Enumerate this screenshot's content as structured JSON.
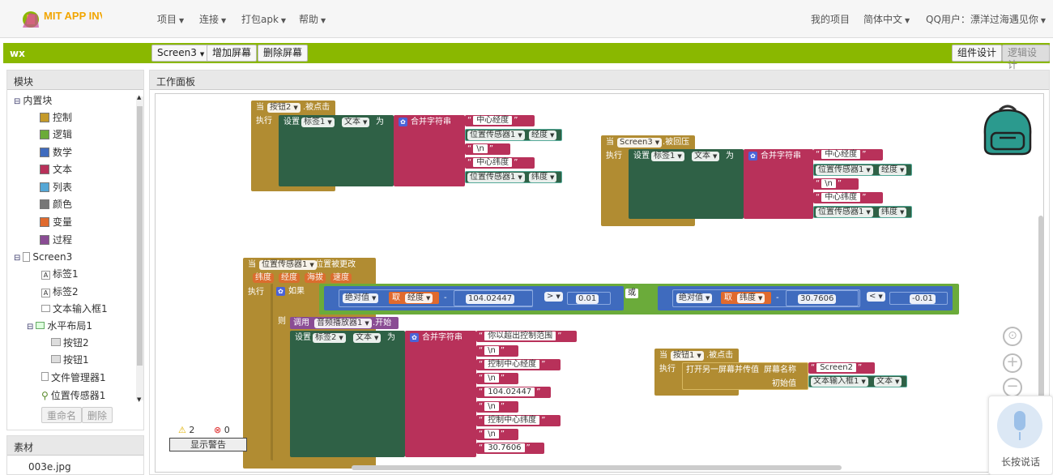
{
  "topbar": {
    "logo_text": "MIT APP INVENTOR",
    "menus": [
      "项目",
      "连接",
      "打包apk",
      "帮助"
    ],
    "my_projects": "我的项目",
    "language": "简体中文",
    "user": "QQ用户：漂洋过海遇见你"
  },
  "projbar": {
    "project_name": "wx",
    "screen_select": "Screen3",
    "add_screen": "增加屏幕",
    "remove_screen": "删除屏幕",
    "designer": "组件设计",
    "blocks": "逻辑设计"
  },
  "left": {
    "title": "模块",
    "builtin": "内置块",
    "builtin_items": [
      {
        "label": "控制",
        "color": "#c49a2a"
      },
      {
        "label": "逻辑",
        "color": "#6bab3a"
      },
      {
        "label": "数学",
        "color": "#3f6bbe"
      },
      {
        "label": "文本",
        "color": "#b8315a"
      },
      {
        "label": "列表",
        "color": "#55a7d6"
      },
      {
        "label": "颜色",
        "color": "#777777"
      },
      {
        "label": "变量",
        "color": "#e06a2e"
      },
      {
        "label": "过程",
        "color": "#8a4c94"
      }
    ],
    "screen": "Screen3",
    "components": [
      "标签1",
      "标签2",
      "文本输入框1",
      "水平布局1",
      "按钮2",
      "按钮1",
      "文件管理器1",
      "位置传感器1"
    ],
    "rename": "重命名",
    "delete": "删除"
  },
  "media": {
    "title": "素材",
    "files": [
      "003e.jpg"
    ]
  },
  "work": {
    "title": "工作面板",
    "warnings": "2",
    "errors": "0",
    "show_warnings": "显示警告",
    "mic_label": "长按说话"
  },
  "blocks": {
    "b1": {
      "when": "当",
      "comp": "按钮2",
      "event": ".被点击",
      "do": "执行",
      "set": "设置",
      "target": "标签1",
      "prop": "文本",
      "to": "为",
      "join": "合并字符串",
      "s1": "中心经度",
      "sensor": "位置传感器1",
      "lon": "经度",
      "nl": "\\n",
      "s2": "中心纬度",
      "lat": "纬度"
    },
    "b2": {
      "when": "当",
      "comp": "Screen3",
      "event": ".被回压",
      "do": "执行",
      "set": "设置",
      "target": "标签1",
      "prop": "文本",
      "to": "为",
      "join": "合并字符串",
      "s1": "中心经度",
      "sensor": "位置传感器1",
      "lon": "经度",
      "nl": "\\n",
      "s2": "中心纬度",
      "lat": "纬度"
    },
    "b3": {
      "when": "当",
      "comp": "位置传感器1",
      "event": ".位置被更改",
      "params": [
        "纬度",
        "经度",
        "海拔",
        "速度"
      ],
      "do": "执行",
      "if": "如果",
      "abs": "绝对值",
      "get": "取",
      "lat": "纬度",
      "lon": "经度",
      "minus": "-",
      "v1": "104.02447",
      "gt": ">",
      "t1": "0.01",
      "or": "或",
      "v2": "30.7606",
      "lt": "<",
      "t2": "-0.01",
      "then": "则",
      "call": "调用",
      "player": "音频播放器1",
      "start": ".开始",
      "set": "设置",
      "target": "标签2",
      "prop": "文本",
      "to": "为",
      "join": "合并字符串",
      "s1": "你以超出控制范围",
      "nl": "\\n",
      "s2": "控制中心经度",
      "n1": "104.02447",
      "s3": "控制中心纬度",
      "n2": "30.7606"
    },
    "b4": {
      "when": "当",
      "comp": "按钮1",
      "event": ".被点击",
      "do": "执行",
      "open": "打开另一屏幕并传值",
      "screen_name": "屏幕名称",
      "screen": "Screen2",
      "init": "初始值",
      "input": "文本输入框1",
      "prop": "文本"
    }
  }
}
